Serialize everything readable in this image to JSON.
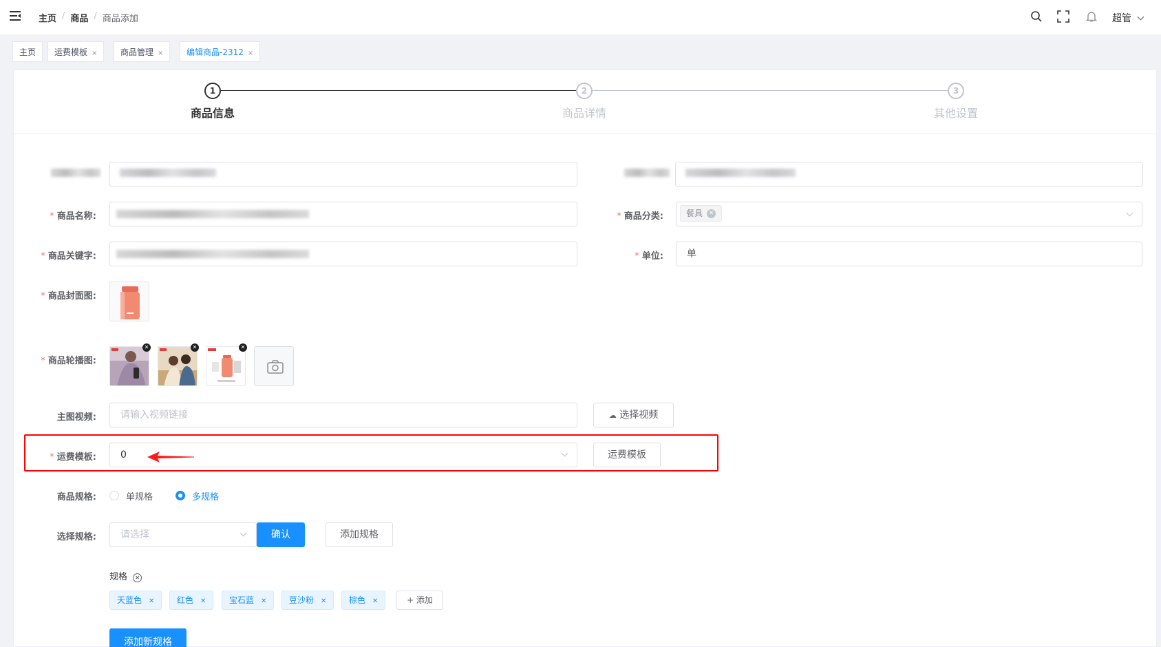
{
  "header": {
    "breadcrumb": [
      "主页",
      "商品",
      "商品添加"
    ],
    "user": "超管"
  },
  "tags": [
    {
      "label": "主页",
      "closable": false
    },
    {
      "label": "运费模板",
      "closable": true
    },
    {
      "label": "商品管理",
      "closable": true
    },
    {
      "label": "编辑商品-2312",
      "closable": true,
      "active": true
    }
  ],
  "steps": [
    {
      "num": "1",
      "title": "商品信息",
      "active": true
    },
    {
      "num": "2",
      "title": "商品详情",
      "active": false
    },
    {
      "num": "3",
      "title": "其他设置",
      "active": false
    }
  ],
  "form": {
    "name_label": "商品名称:",
    "category_label": "商品分类:",
    "category_tag": "餐具",
    "keyword_label": "商品关键字:",
    "unit_label": "单位:",
    "unit_value": "单",
    "cover_label": "商品封面图:",
    "carousel_label": "商品轮播图:",
    "video_label": "主图视频:",
    "video_placeholder": "请输入视频链接",
    "video_button": "选择视频",
    "shipping_label": "运费模板:",
    "shipping_value": "0",
    "shipping_button": "运费模板",
    "spec_type_label": "商品规格:",
    "spec_single": "单规格",
    "spec_multi": "多规格",
    "select_spec_label": "选择规格:",
    "select_placeholder": "请选择",
    "confirm_button": "确认",
    "add_spec_button": "添加规格",
    "spec_group_title": "规格",
    "spec_values": [
      "天蓝色",
      "红色",
      "宝石蓝",
      "豆沙粉",
      "棕色"
    ],
    "add_value_button": "+ 添加",
    "add_new_spec_button": "添加新规格"
  },
  "colors": {
    "primary": "#1890ff",
    "required": "#f56c6c",
    "highlight": "#ff0000"
  }
}
